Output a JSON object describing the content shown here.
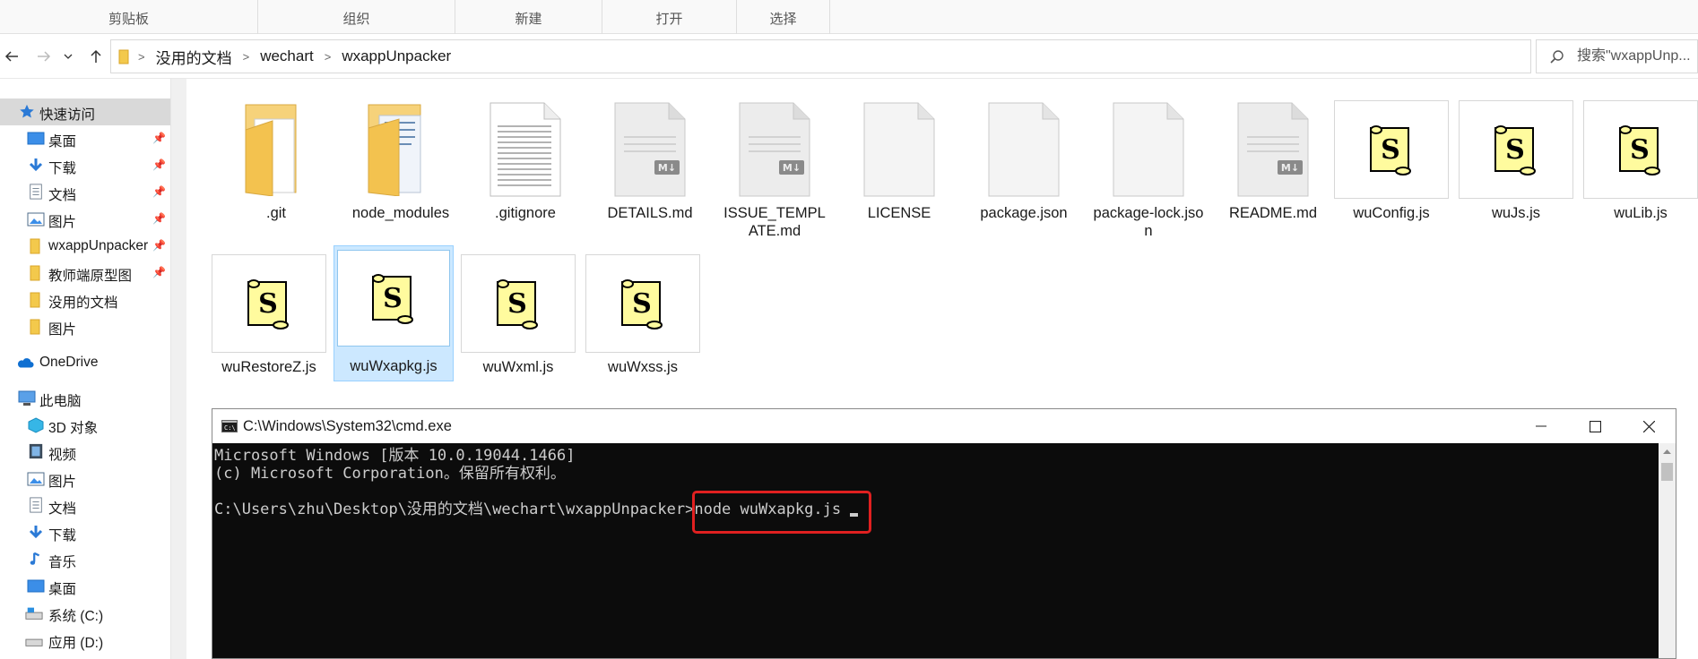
{
  "ribbon": {
    "groups": [
      "剪贴板",
      "组织",
      "新建",
      "打开",
      "选择"
    ]
  },
  "address": {
    "crumbs": [
      "没用的文档",
      "wechart",
      "wxappUnpacker"
    ],
    "search_placeholder": "搜索\"wxappUnp..."
  },
  "sidebar": {
    "quick_access": "快速访问",
    "quick_items": [
      {
        "label": "桌面",
        "icon": "desktop-icon",
        "pinned": true
      },
      {
        "label": "下载",
        "icon": "download-icon",
        "pinned": true
      },
      {
        "label": "文档",
        "icon": "document-icon",
        "pinned": true
      },
      {
        "label": "图片",
        "icon": "picture-icon",
        "pinned": true
      },
      {
        "label": "wxappUnpacker",
        "icon": "folder-icon",
        "pinned": true
      },
      {
        "label": "教师端原型图",
        "icon": "folder-icon",
        "pinned": true
      },
      {
        "label": "没用的文档",
        "icon": "folder-icon",
        "pinned": false
      },
      {
        "label": "图片",
        "icon": "folder-icon",
        "pinned": false
      }
    ],
    "onedrive": "OneDrive",
    "this_pc": "此电脑",
    "pc_items": [
      {
        "label": "3D 对象",
        "icon": "cube-icon"
      },
      {
        "label": "视频",
        "icon": "video-icon"
      },
      {
        "label": "图片",
        "icon": "picture-icon"
      },
      {
        "label": "文档",
        "icon": "document-icon"
      },
      {
        "label": "下载",
        "icon": "download-icon"
      },
      {
        "label": "音乐",
        "icon": "music-icon"
      },
      {
        "label": "桌面",
        "icon": "desktop-icon"
      },
      {
        "label": "系统 (C:)",
        "icon": "drive-icon"
      },
      {
        "label": "应用 (D:)",
        "icon": "drive-icon"
      }
    ]
  },
  "files": [
    {
      "name": ".git",
      "icon": "folder-icon"
    },
    {
      "name": "node_modules",
      "icon": "folder-icon"
    },
    {
      "name": ".gitignore",
      "icon": "text-file-icon"
    },
    {
      "name": "DETAILS.md",
      "icon": "markdown-file-icon"
    },
    {
      "name": "ISSUE_TEMPLATE.md",
      "icon": "markdown-file-icon"
    },
    {
      "name": "LICENSE",
      "icon": "blank-file-icon"
    },
    {
      "name": "package.json",
      "icon": "blank-file-icon"
    },
    {
      "name": "package-lock.json",
      "icon": "blank-file-icon"
    },
    {
      "name": "README.md",
      "icon": "markdown-file-icon"
    },
    {
      "name": "wuConfig.js",
      "icon": "script-file-icon"
    },
    {
      "name": "wuJs.js",
      "icon": "script-file-icon"
    },
    {
      "name": "wuLib.js",
      "icon": "script-file-icon"
    },
    {
      "name": "wuRestoreZ.js",
      "icon": "script-file-icon"
    },
    {
      "name": "wuWxapkg.js",
      "icon": "script-file-icon",
      "selected": true
    },
    {
      "name": "wuWxml.js",
      "icon": "script-file-icon"
    },
    {
      "name": "wuWxss.js",
      "icon": "script-file-icon"
    }
  ],
  "cmd": {
    "title": "C:\\Windows\\System32\\cmd.exe",
    "lines": [
      "Microsoft Windows [版本 10.0.19044.1466]",
      "(c) Microsoft Corporation。保留所有权利。",
      ""
    ],
    "prompt": "C:\\Users\\zhu\\Desktop\\没用的文档\\wechart\\wxappUnpacker>",
    "command": "node wuWxapkg.js"
  },
  "colors": {
    "selection": "#cce8ff",
    "highlight_box": "#e02020",
    "console_bg": "#0c0c0c",
    "console_fg": "#cccccc"
  }
}
